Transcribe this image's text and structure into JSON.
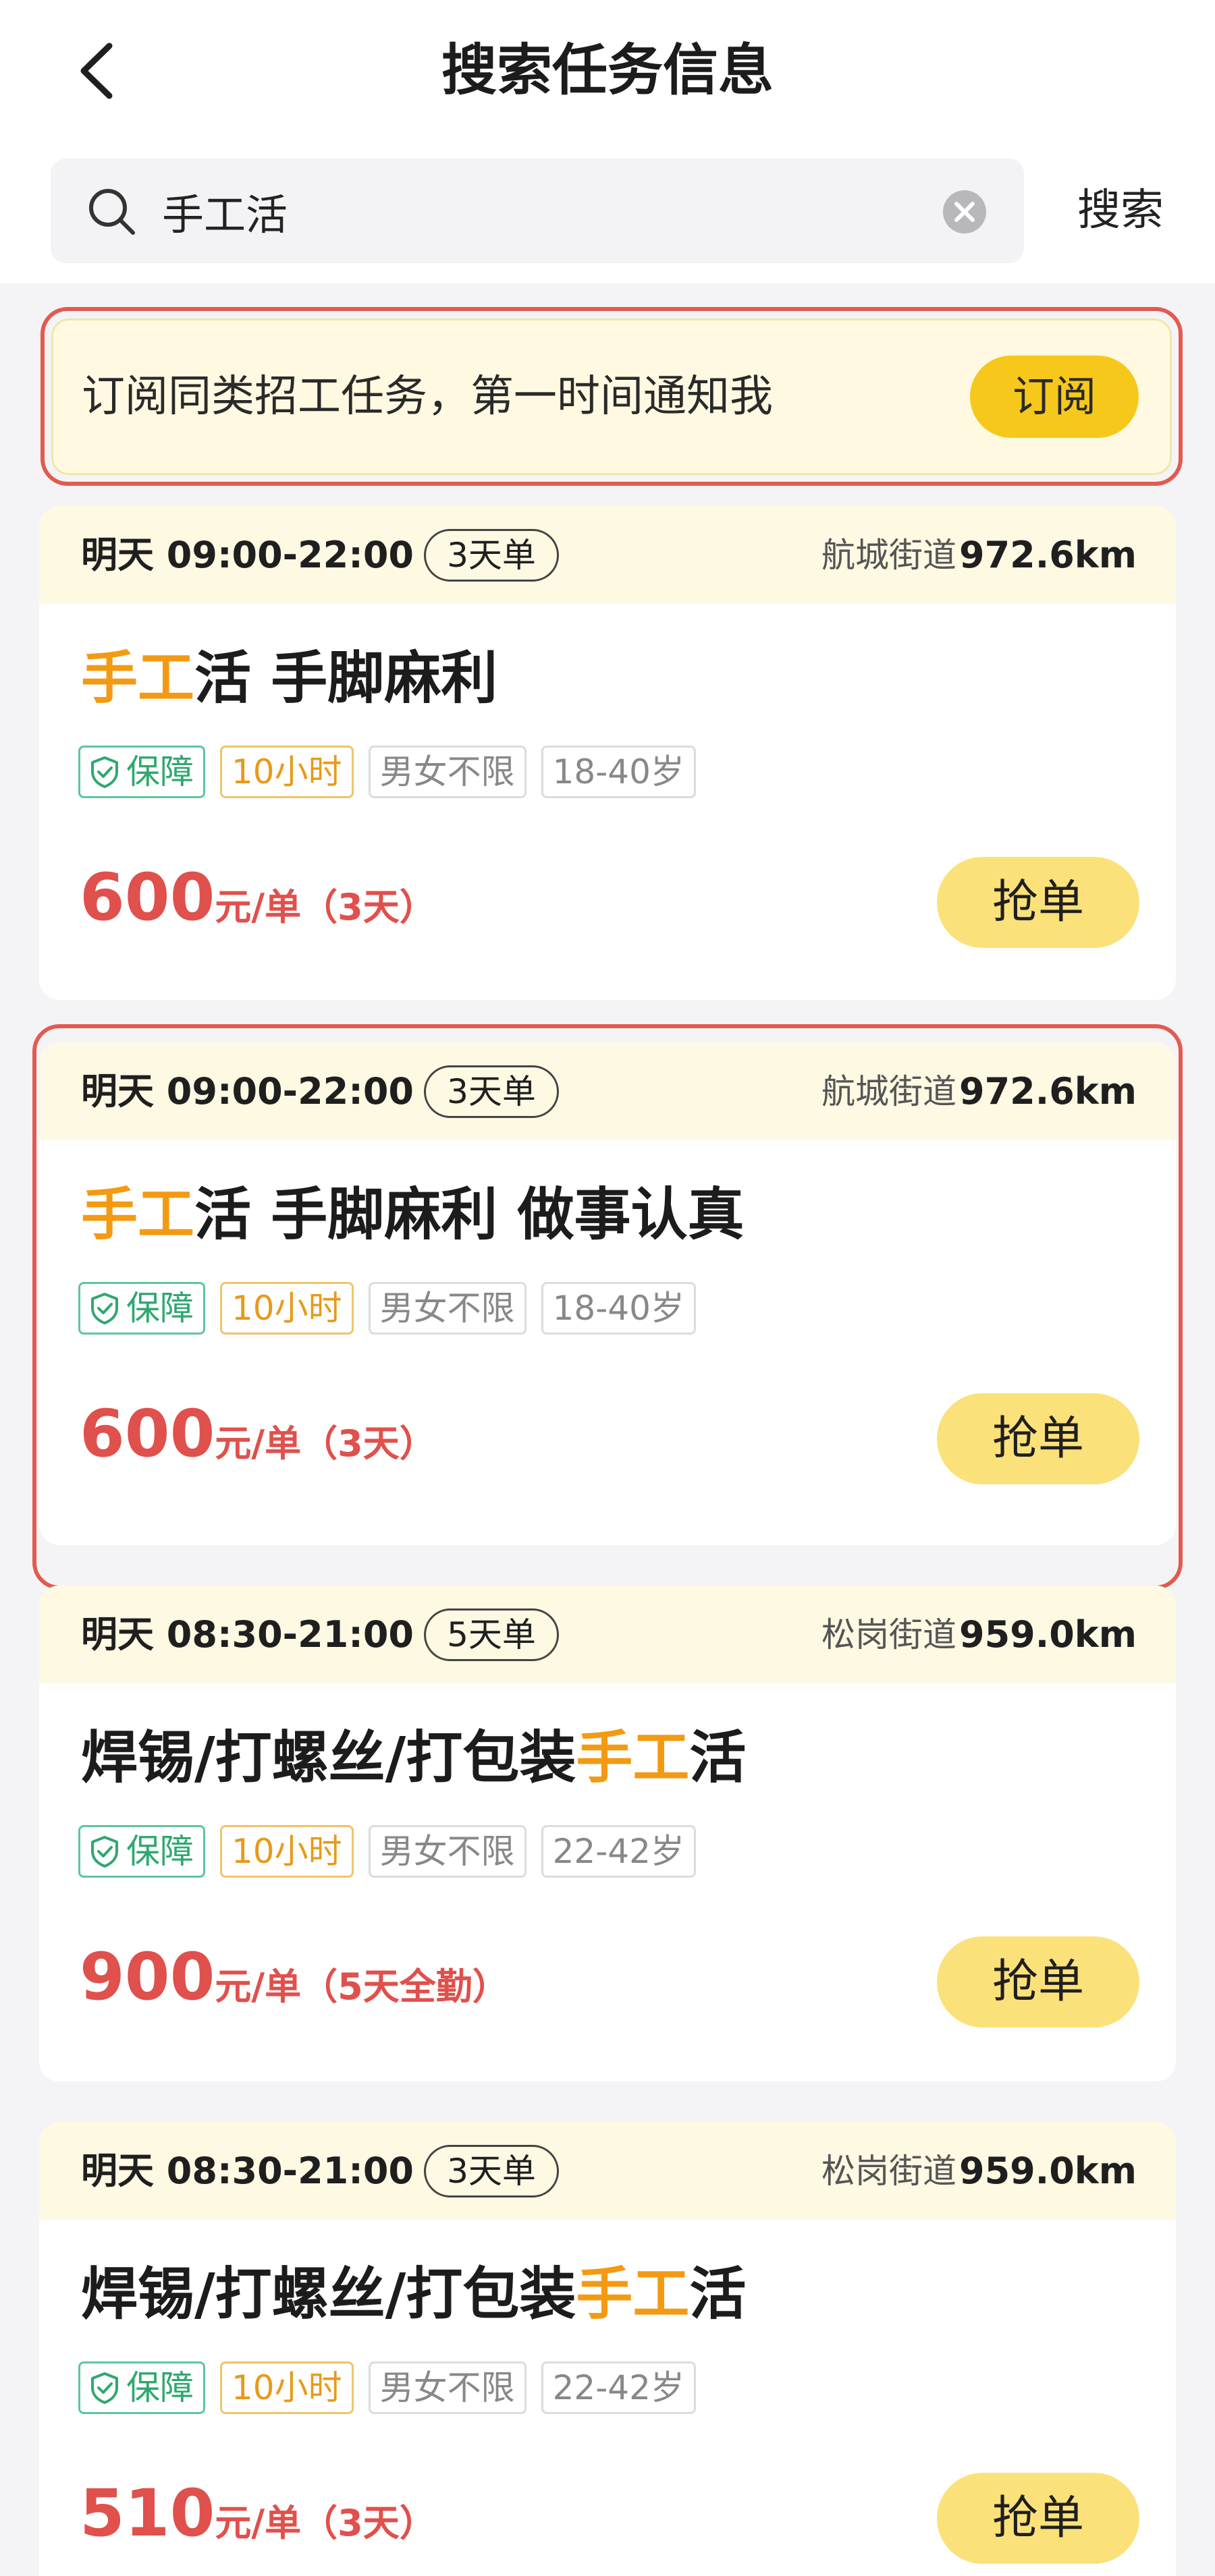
{
  "header": {
    "title": "搜索任务信息"
  },
  "search": {
    "value": "手工活",
    "button_label": "搜索"
  },
  "subscribe": {
    "text": "订阅同类招工任务，第一时间通知我",
    "button_label": "订阅"
  },
  "jobs": [
    {
      "time": "明天 09:00-22:00",
      "order_type": "3天单",
      "location": "航城街道",
      "distance": "972.6km",
      "title_highlight": "手工",
      "title_rest": "活 手脚麻利",
      "tags": {
        "guarantee": "保障",
        "hours": "10小时",
        "gender": "男女不限",
        "age": "18-40岁"
      },
      "price": "600",
      "price_unit": "元/单",
      "price_note": "（3天）",
      "button_label": "抢单"
    },
    {
      "time": "明天 09:00-22:00",
      "order_type": "3天单",
      "location": "航城街道",
      "distance": "972.6km",
      "title_highlight": "手工",
      "title_rest": "活 手脚麻利 做事认真",
      "tags": {
        "guarantee": "保障",
        "hours": "10小时",
        "gender": "男女不限",
        "age": "18-40岁"
      },
      "price": "600",
      "price_unit": "元/单",
      "price_note": "（3天）",
      "button_label": "抢单"
    },
    {
      "time": "明天 08:30-21:00",
      "order_type": "5天单",
      "location": "松岗街道",
      "distance": "959.0km",
      "title_prefix": "焊锡/打螺丝/打包装",
      "title_highlight": "手工",
      "title_rest": "活",
      "tags": {
        "guarantee": "保障",
        "hours": "10小时",
        "gender": "男女不限",
        "age": "22-42岁"
      },
      "price": "900",
      "price_unit": "元/单",
      "price_note": "（5天全勤）",
      "button_label": "抢单"
    },
    {
      "time": "明天 08:30-21:00",
      "order_type": "3天单",
      "location": "松岗街道",
      "distance": "959.0km",
      "title_prefix": "焊锡/打螺丝/打包装",
      "title_highlight": "手工",
      "title_rest": "活",
      "tags": {
        "guarantee": "保障",
        "hours": "10小时",
        "gender": "男女不限",
        "age": "22-42岁"
      },
      "price": "510",
      "price_unit": "元/单",
      "price_note": "（3天）",
      "button_label": "抢单"
    }
  ],
  "colors": {
    "accent_yellow": "#f7c81c",
    "highlight_orange": "#f39a13",
    "price_red": "#e0504c",
    "annotation_red": "#e35a50"
  }
}
